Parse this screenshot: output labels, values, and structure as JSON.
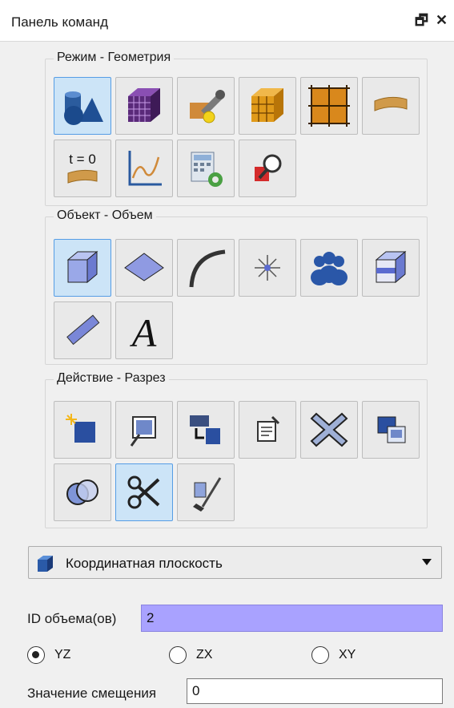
{
  "panel": {
    "title": "Панель команд",
    "float_glyph": "🗗",
    "close_glyph": "✕"
  },
  "groups": {
    "mode": {
      "title": "Режим - Геометрия",
      "tools": [
        "geometry-icon",
        "mesh-icon",
        "boundary-conditions-icon",
        "blocks-icon",
        "sidesets-icon",
        "material-strip-icon",
        "t0-icon",
        "curve-plot-icon",
        "calculator-settings-icon",
        "inspect-icon"
      ],
      "t0_label": "t = 0"
    },
    "object": {
      "title": "Объект - Объем",
      "tools": [
        "volume-cube-icon",
        "surface-icon",
        "curve-arc-icon",
        "vertex-icon",
        "group-icon",
        "body-icon",
        "measure-ruler-icon",
        "text-a-icon"
      ],
      "text_glyph": "A"
    },
    "action": {
      "title": "Действие - Разрез",
      "tools": [
        "create-icon",
        "modify-icon",
        "transform-icon",
        "properties-icon",
        "delete-icon",
        "copy-icon",
        "boolean-icon",
        "webcut-icon",
        "cleanup-icon"
      ]
    }
  },
  "dropdown": {
    "selected": "Координатная плоскость",
    "icon": "cube-icon"
  },
  "form": {
    "id_label": "ID объема(ов)",
    "id_value": "2",
    "radios": [
      {
        "label": "YZ",
        "checked": true
      },
      {
        "label": "ZX",
        "checked": false
      },
      {
        "label": "XY",
        "checked": false
      }
    ],
    "offset_label": "Значение смещения",
    "offset_value": "0"
  },
  "colors": {
    "active_bg": "#cce4f7",
    "active_border": "#569de5",
    "id_field_bg": "#a9a2ff"
  }
}
